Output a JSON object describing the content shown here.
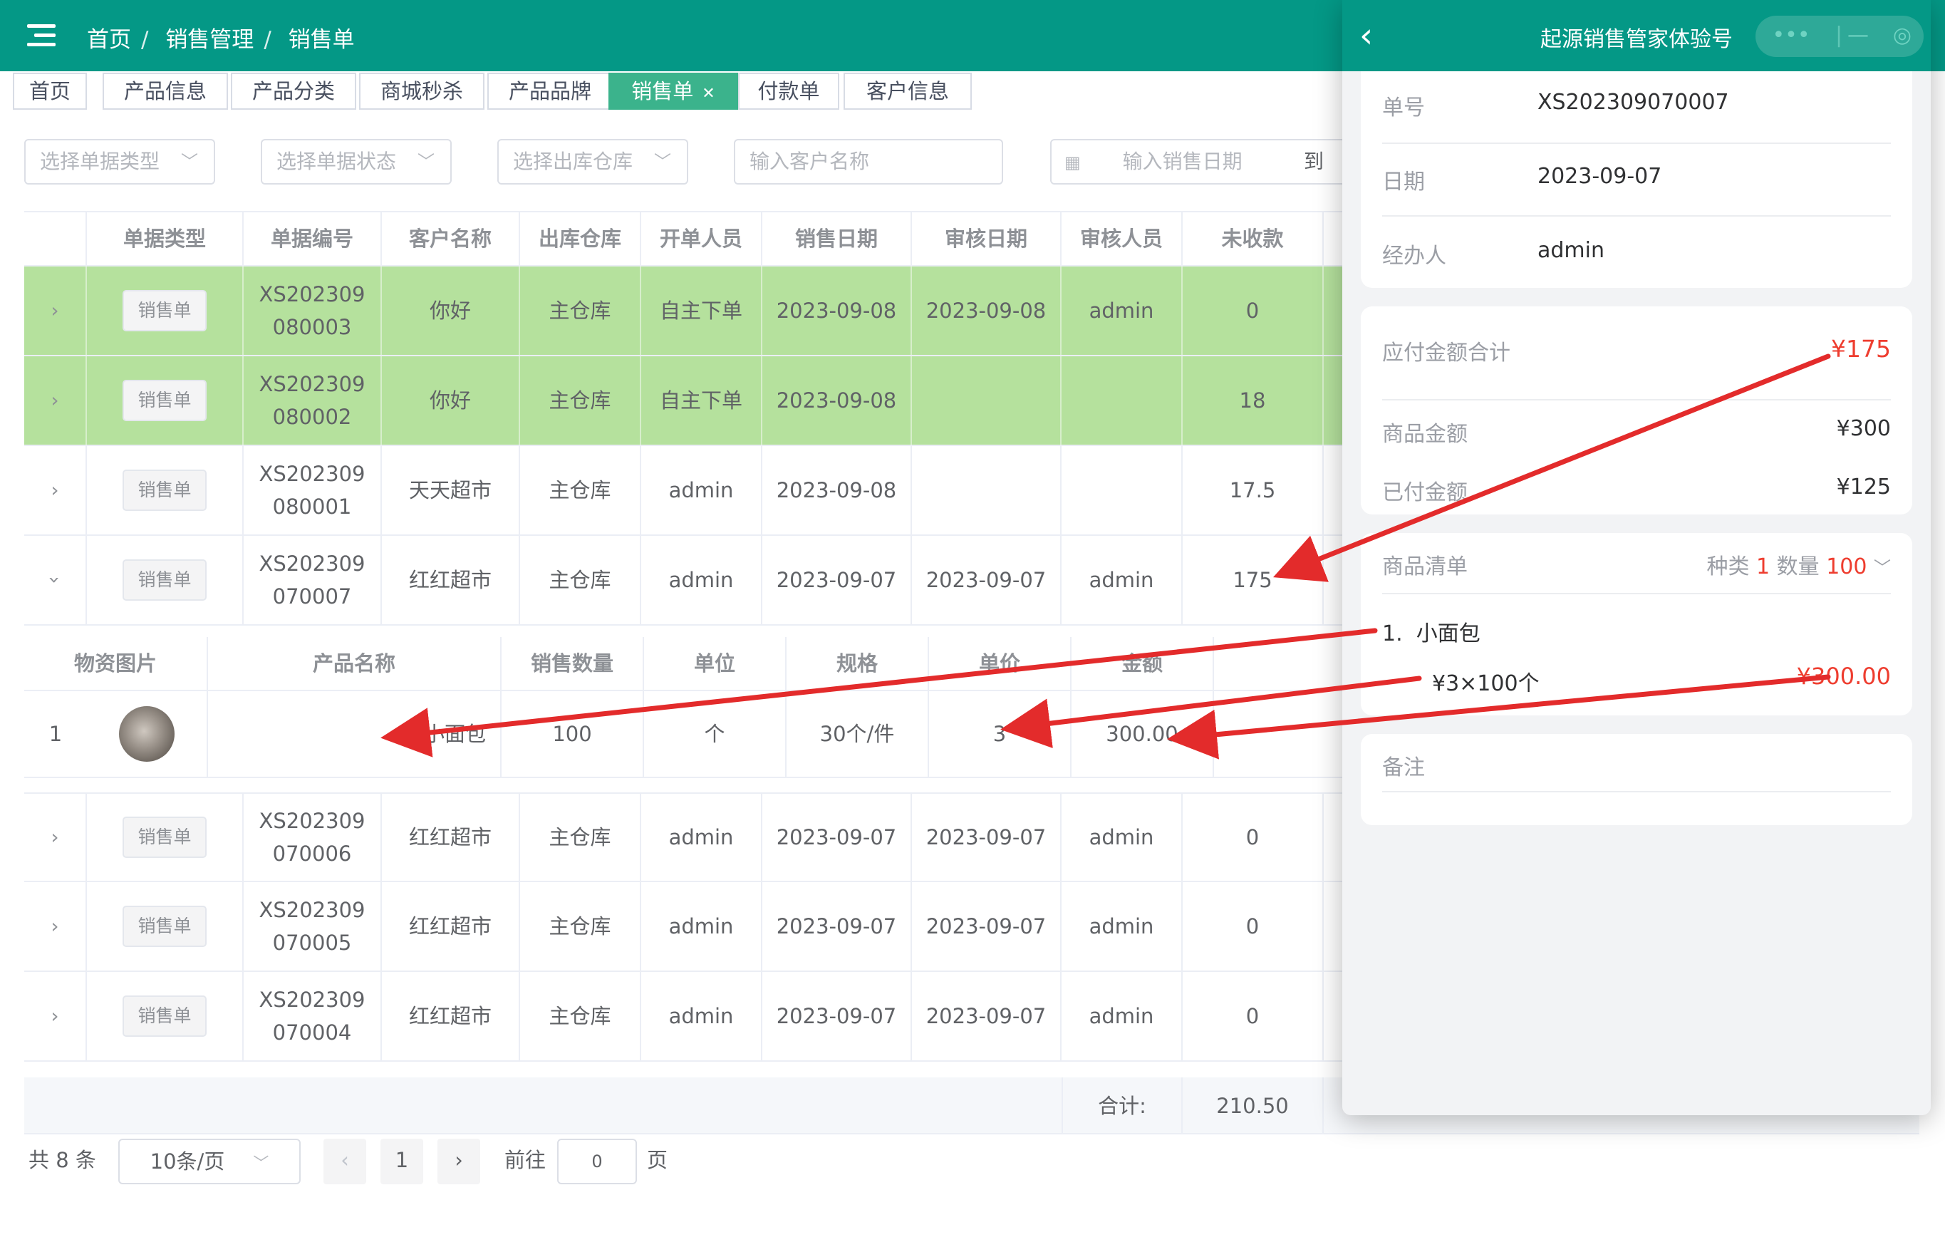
{
  "header": {
    "breadcrumb": [
      "首页",
      "销售管理",
      "销售单"
    ]
  },
  "tabs": [
    {
      "label": "首页",
      "active": false
    },
    {
      "label": "产品信息",
      "active": false
    },
    {
      "label": "产品分类",
      "active": false
    },
    {
      "label": "商城秒杀",
      "active": false
    },
    {
      "label": "产品品牌",
      "active": false
    },
    {
      "label": "销售单",
      "active": true
    },
    {
      "label": "付款单",
      "active": false
    },
    {
      "label": "客户信息",
      "active": false
    }
  ],
  "filters": {
    "doc_type_placeholder": "选择单据类型",
    "doc_status_placeholder": "选择单据状态",
    "warehouse_placeholder": "选择出库仓库",
    "customer_placeholder": "输入客户名称",
    "sale_date_placeholder": "输入销售日期",
    "date_to": "到"
  },
  "table": {
    "columns": [
      "单据类型",
      "单据编号",
      "客户名称",
      "出库仓库",
      "开单人员",
      "销售日期",
      "审核日期",
      "审核人员",
      "未收款"
    ],
    "rows": [
      {
        "type": "销售单",
        "no_line1": "XS202309",
        "no_line2": "080003",
        "customer": "你好",
        "warehouse": "主仓库",
        "creator": "自主下单",
        "sale_date": "2023-09-08",
        "audit_date": "2023-09-08",
        "auditor": "admin",
        "unpaid": "0",
        "expanded": false
      },
      {
        "type": "销售单",
        "no_line1": "XS202309",
        "no_line2": "080002",
        "customer": "你好",
        "warehouse": "主仓库",
        "creator": "自主下单",
        "sale_date": "2023-09-08",
        "audit_date": "",
        "auditor": "",
        "unpaid": "18",
        "expanded": false
      },
      {
        "type": "销售单",
        "no_line1": "XS202309",
        "no_line2": "080001",
        "customer": "天天超市",
        "warehouse": "主仓库",
        "creator": "admin",
        "sale_date": "2023-09-08",
        "audit_date": "",
        "auditor": "",
        "unpaid": "17.5",
        "expanded": false
      },
      {
        "type": "销售单",
        "no_line1": "XS202309",
        "no_line2": "070007",
        "customer": "红红超市",
        "warehouse": "主仓库",
        "creator": "admin",
        "sale_date": "2023-09-07",
        "audit_date": "2023-09-07",
        "auditor": "admin",
        "unpaid": "175",
        "expanded": true
      },
      {
        "type": "销售单",
        "no_line1": "XS202309",
        "no_line2": "070006",
        "customer": "红红超市",
        "warehouse": "主仓库",
        "creator": "admin",
        "sale_date": "2023-09-07",
        "audit_date": "2023-09-07",
        "auditor": "admin",
        "unpaid": "0",
        "expanded": false
      },
      {
        "type": "销售单",
        "no_line1": "XS202309",
        "no_line2": "070005",
        "customer": "红红超市",
        "warehouse": "主仓库",
        "creator": "admin",
        "sale_date": "2023-09-07",
        "audit_date": "2023-09-07",
        "auditor": "admin",
        "unpaid": "0",
        "expanded": false
      },
      {
        "type": "销售单",
        "no_line1": "XS202309",
        "no_line2": "070004",
        "customer": "红红超市",
        "warehouse": "主仓库",
        "creator": "admin",
        "sale_date": "2023-09-07",
        "audit_date": "2023-09-07",
        "auditor": "admin",
        "unpaid": "0",
        "expanded": false
      }
    ],
    "sub_columns": [
      "物资图片",
      "产品名称",
      "销售数量",
      "单位",
      "规格",
      "单价",
      "金额"
    ],
    "sub_rows": [
      {
        "index": "1",
        "name": "小面包",
        "qty": "100",
        "unit": "个",
        "spec": "30个/件",
        "price": "3",
        "amount": "300.00"
      }
    ],
    "sum_label": "合计:",
    "sum_value": "210.50"
  },
  "pagination": {
    "total": "共 8 条",
    "page_size": "10条/页",
    "current_page": "1",
    "goto_label": "前往",
    "goto_value": "0",
    "page_suffix": "页"
  },
  "phone": {
    "title": "起源销售管家体验号",
    "order_no_label": "单号",
    "order_no": "XS202309070007",
    "date_label": "日期",
    "date": "2023-09-07",
    "handler_label": "经办人",
    "handler": "admin",
    "payable_label": "应付金额合计",
    "payable": "¥175",
    "goods_amount_label": "商品金额",
    "goods_amount": "¥300",
    "paid_label": "已付金额",
    "paid": "¥125",
    "list_label": "商品清单",
    "kind_label": "种类",
    "kind_value": "1",
    "qty_label": "数量",
    "qty_value": "100",
    "item_index": "1.",
    "item_name": "小面包",
    "item_detail": "¥3×100个",
    "item_amount": "¥300.00",
    "remark_label": "备注"
  },
  "colors": {
    "header_bg": "#049886",
    "active_tab": "#3bb38c",
    "highlight_row": "#b5e19d",
    "annotation_arrow": "#e32b2b",
    "price_red": "#ee3d2f"
  }
}
